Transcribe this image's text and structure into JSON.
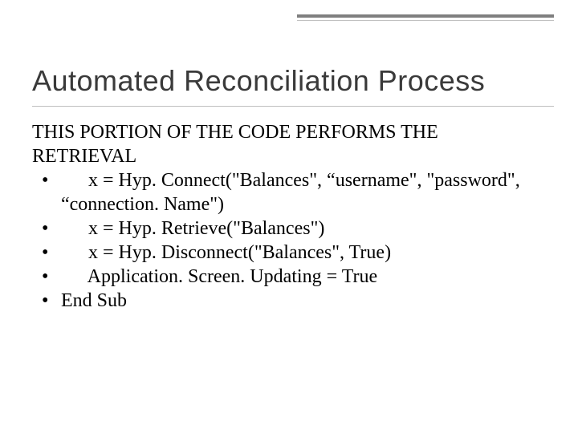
{
  "slide": {
    "title": "Automated Reconciliation Process",
    "intro": "THIS PORTION OF THE CODE PERFORMS THE RETRIEVAL",
    "bullets": [
      "    x = Hyp. Connect(\"Balances\", “username\", \"password\", “connection. Name\")",
      "    x = Hyp. Retrieve(\"Balances\")",
      "    x = Hyp. Disconnect(\"Balances\", True)",
      "    Application. Screen. Updating = True",
      "",
      "End Sub"
    ]
  }
}
